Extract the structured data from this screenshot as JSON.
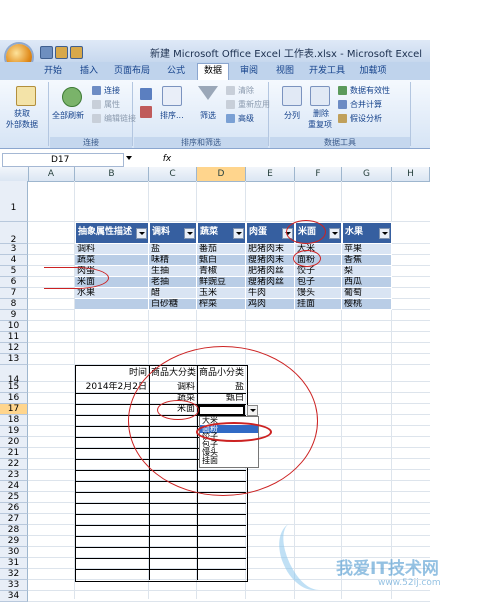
{
  "window": {
    "title": "新建 Microsoft Office Excel 工作表.xlsx - Microsoft Excel"
  },
  "tabs": [
    "开始",
    "插入",
    "页面布局",
    "公式",
    "数据",
    "审阅",
    "视图",
    "开发工具",
    "加载项"
  ],
  "active_tab": "数据",
  "ribbon": {
    "groups": [
      {
        "label": "",
        "items": [
          "获取",
          "外部数据"
        ]
      },
      {
        "label": "连接",
        "items": [
          "全部刷新",
          "连接",
          "属性",
          "编辑链接"
        ]
      },
      {
        "label": "排序和筛选",
        "items": [
          "排序...",
          "筛选",
          "清除",
          "重新应用",
          "高级"
        ]
      },
      {
        "label": "数据工具",
        "items": [
          "分列",
          "删除",
          "重复项",
          "数据有效性",
          "合并计算",
          "假设分析"
        ]
      }
    ]
  },
  "formula_bar": {
    "name_box": "D17",
    "fx_label": "fx",
    "formula": ""
  },
  "columns": [
    "A",
    "B",
    "C",
    "D",
    "E",
    "F",
    "G",
    "H"
  ],
  "selected_column": "D",
  "rows": [
    "1",
    "2",
    "3",
    "4",
    "5",
    "6",
    "7",
    "8",
    "9",
    "10",
    "11",
    "12",
    "13",
    "14",
    "15",
    "16",
    "17",
    "18",
    "19",
    "20",
    "21",
    "22",
    "23",
    "24",
    "25",
    "26",
    "27",
    "28",
    "29",
    "30",
    "31",
    "32",
    "33",
    "34"
  ],
  "selected_row": "17",
  "table1": {
    "headers": [
      "抽象属性描述",
      "调料",
      "蔬菜",
      "肉蛋",
      "米面",
      "水果"
    ],
    "rows": [
      [
        "调料",
        "盐",
        "番茄",
        "肥猪肉末",
        "大米",
        "苹果"
      ],
      [
        "蔬菜",
        "味精",
        "甄白",
        "瘦猪肉末",
        "面粉",
        "香蕉"
      ],
      [
        "肉蛋",
        "生抽",
        "青椒",
        "肥猪肉丝",
        "饺子",
        "梨"
      ],
      [
        "米面",
        "老抽",
        "鲜豌豆",
        "瘦猪肉丝",
        "包子",
        "西瓜"
      ],
      [
        "水果",
        "醋",
        "玉米",
        "牛肉",
        "馒头",
        "葡萄"
      ],
      [
        "",
        "白砂糖",
        "榨菜",
        "鸡肉",
        "挂面",
        "樱桃"
      ]
    ]
  },
  "table2": {
    "headers": [
      "时间",
      "商品大分类",
      "商品小分类"
    ],
    "rows": [
      [
        "2014年2月2日",
        "调料",
        "盐"
      ],
      [
        "",
        "蔬菜",
        "甄白"
      ],
      [
        "",
        "米面",
        ""
      ]
    ]
  },
  "dropdown_list": {
    "items": [
      "大米",
      "面粉",
      "饺子",
      "包子",
      "馒头",
      "挂面"
    ],
    "highlighted": 1
  },
  "watermark": {
    "text": "我爱IT技术网",
    "url": "www.52ij.com"
  },
  "colors": {
    "header_fill": "#365fa0",
    "band_light": "#d9e4f3",
    "band_dark": "#b9cde6",
    "annotation_red": "#cc2222",
    "selection": "#ffd58d"
  }
}
